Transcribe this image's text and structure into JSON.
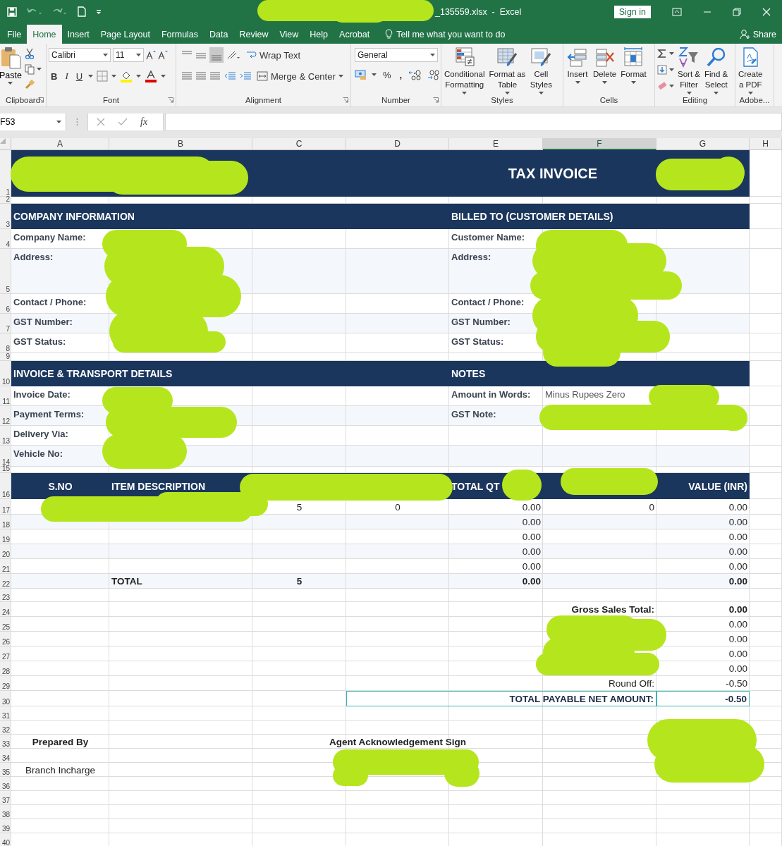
{
  "title_bar": {
    "title": "_135559.xlsx  -  Excel",
    "sign_in": "Sign in"
  },
  "menu_tabs": [
    {
      "label": "File",
      "selected": false
    },
    {
      "label": "Home",
      "selected": true
    },
    {
      "label": "Insert",
      "selected": false
    },
    {
      "label": "Page Layout",
      "selected": false
    },
    {
      "label": "Formulas",
      "selected": false
    },
    {
      "label": "Data",
      "selected": false
    },
    {
      "label": "Review",
      "selected": false
    },
    {
      "label": "View",
      "selected": false
    },
    {
      "label": "Help",
      "selected": false
    },
    {
      "label": "Acrobat",
      "selected": false
    }
  ],
  "tell_me": "Tell me what you want to do",
  "share": "Share",
  "ribbon": {
    "groups": [
      {
        "kind": "clipboard",
        "label": "Clipboard",
        "paste": "Paste"
      },
      {
        "kind": "font",
        "label": "Font",
        "font_name": "Calibri",
        "font_size": "11",
        "bold": "B",
        "italic": "I",
        "underline": "U"
      },
      {
        "kind": "alignment",
        "label": "Alignment",
        "wrap_text": "Wrap Text",
        "merge": "Merge & Center"
      },
      {
        "kind": "number",
        "label": "Number",
        "format": "General",
        "percent": "%",
        "comma": ","
      },
      {
        "kind": "large",
        "label": "Styles",
        "buttons": [
          {
            "kind": "conditional",
            "text": "Conditional\nFormatting"
          },
          {
            "kind": "table",
            "text": "Format as\nTable"
          },
          {
            "kind": "cell-styles",
            "text": "Cell\nStyles"
          }
        ]
      },
      {
        "kind": "large",
        "label": "Cells",
        "buttons": [
          {
            "kind": "insert",
            "text": "Insert"
          },
          {
            "kind": "delete",
            "text": "Delete"
          },
          {
            "kind": "format",
            "text": "Format"
          }
        ]
      },
      {
        "kind": "editing",
        "label": "Editing",
        "buttons": [
          {
            "kind": "sort",
            "text": "Sort &\nFilter"
          },
          {
            "kind": "find",
            "text": "Find &\nSelect"
          }
        ]
      },
      {
        "kind": "large",
        "label": "Adobe...",
        "buttons": [
          {
            "kind": "pdf",
            "text": "Create\na PDF"
          }
        ]
      }
    ]
  },
  "formula_bar": {
    "name_box": "F53",
    "function_button": "fx"
  },
  "sheet": {
    "columns": [
      {
        "label": "A",
        "selected": false
      },
      {
        "label": "B",
        "selected": false
      },
      {
        "label": "C",
        "selected": false
      },
      {
        "label": "D",
        "selected": false
      },
      {
        "label": "E",
        "selected": false
      },
      {
        "label": "F",
        "selected": true
      },
      {
        "label": "G",
        "selected": false
      },
      {
        "label": "H",
        "selected": false
      }
    ],
    "rows": [
      {
        "number": "1",
        "kind": "banner",
        "cells": {
          "E": {
            "kind": "title",
            "text": "TAX INVOICE"
          }
        }
      },
      {
        "number": "2",
        "kind": "plain"
      },
      {
        "number": "3",
        "kind": "banner",
        "cells": {
          "A": {
            "kind": "section",
            "text": "COMPANY INFORMATION"
          },
          "E": {
            "kind": "section",
            "text": "BILLED TO (CUSTOMER DETAILS)"
          }
        }
      },
      {
        "number": "4",
        "kind": "plain",
        "cells": {
          "A": {
            "kind": "label",
            "text": "Company Name:"
          },
          "E": {
            "kind": "label",
            "text": "Customer Name:"
          }
        }
      },
      {
        "number": "5",
        "kind": "shaded",
        "cells": {
          "A": {
            "kind": "label",
            "text": "Address:"
          },
          "E": {
            "kind": "label",
            "text": "Address:"
          }
        }
      },
      {
        "number": "6",
        "kind": "plain",
        "cells": {
          "A": {
            "kind": "label",
            "text": "Contact / Phone:"
          },
          "E": {
            "kind": "label",
            "text": "Contact / Phone:"
          }
        }
      },
      {
        "number": "7",
        "kind": "shaded",
        "cells": {
          "A": {
            "kind": "label",
            "text": "GST Number:"
          },
          "E": {
            "kind": "label",
            "text": "GST Number:"
          }
        }
      },
      {
        "number": "8",
        "kind": "plain",
        "cells": {
          "A": {
            "kind": "label",
            "text": "GST Status:"
          },
          "E": {
            "kind": "label",
            "text": "GST Status:"
          }
        }
      },
      {
        "number": "9",
        "kind": "plain"
      },
      {
        "number": "10",
        "kind": "banner",
        "cells": {
          "A": {
            "kind": "section",
            "text": "INVOICE & TRANSPORT DETAILS"
          },
          "E": {
            "kind": "section",
            "text": "NOTES"
          }
        }
      },
      {
        "number": "11",
        "kind": "plain",
        "cells": {
          "A": {
            "kind": "label",
            "text": "Invoice Date:"
          },
          "E": {
            "kind": "label",
            "text": "Amount in Words:"
          },
          "F": {
            "kind": "note",
            "text": "Minus Rupees Zero"
          }
        }
      },
      {
        "number": "12",
        "kind": "shaded",
        "cells": {
          "A": {
            "kind": "label",
            "text": "Payment Terms:"
          },
          "E": {
            "kind": "label",
            "text": "GST Note:"
          }
        }
      },
      {
        "number": "13",
        "kind": "plain",
        "cells": {
          "A": {
            "kind": "label",
            "text": "Delivery Via:"
          }
        }
      },
      {
        "number": "14",
        "kind": "shaded",
        "cells": {
          "A": {
            "kind": "label",
            "text": "Vehicle No:"
          }
        }
      },
      {
        "number": "15",
        "kind": "plain"
      },
      {
        "number": "16",
        "kind": "banner",
        "cells": {
          "A": {
            "kind": "head-center",
            "text": "S.NO"
          },
          "B": {
            "kind": "head",
            "text": "ITEM DESCRIPTION"
          },
          "E": {
            "kind": "head",
            "text": "TOTAL QT"
          },
          "G": {
            "kind": "head-right",
            "text": "VALUE (INR)"
          }
        }
      },
      {
        "number": "17",
        "kind": "plain",
        "cells": {
          "C": {
            "kind": "qty",
            "text": "5"
          },
          "D": {
            "kind": "qty",
            "text": "0"
          },
          "E": {
            "kind": "amount",
            "text": "0.00"
          },
          "F": {
            "kind": "amount",
            "text": "0"
          },
          "G": {
            "kind": "amount",
            "text": "0.00"
          }
        }
      },
      {
        "number": "18",
        "kind": "shaded",
        "cells": {
          "E": {
            "kind": "amount",
            "text": "0.00"
          },
          "G": {
            "kind": "amount",
            "text": "0.00"
          }
        }
      },
      {
        "number": "19",
        "kind": "plain",
        "cells": {
          "E": {
            "kind": "amount",
            "text": "0.00"
          },
          "G": {
            "kind": "amount",
            "text": "0.00"
          }
        }
      },
      {
        "number": "20",
        "kind": "shaded",
        "cells": {
          "E": {
            "kind": "amount",
            "text": "0.00"
          },
          "G": {
            "kind": "amount",
            "text": "0.00"
          }
        }
      },
      {
        "number": "21",
        "kind": "plain",
        "cells": {
          "E": {
            "kind": "amount",
            "text": "0.00"
          },
          "G": {
            "kind": "amount",
            "text": "0.00"
          }
        }
      },
      {
        "number": "22",
        "kind": "shaded",
        "cells": {
          "B": {
            "kind": "total-label",
            "text": "TOTAL"
          },
          "C": {
            "kind": "qty-bold",
            "text": "5"
          },
          "E": {
            "kind": "amount-bold",
            "text": "0.00"
          },
          "G": {
            "kind": "amount-bold",
            "text": "0.00"
          }
        }
      },
      {
        "number": "23",
        "kind": "plain"
      },
      {
        "number": "24",
        "kind": "plain",
        "cells": {
          "F": {
            "kind": "summary-label-bold",
            "text": "Gross Sales Total:"
          },
          "G": {
            "kind": "amount-bold",
            "text": "0.00"
          }
        }
      },
      {
        "number": "25",
        "kind": "plain",
        "cells": {
          "G": {
            "kind": "amount",
            "text": "0.00"
          }
        }
      },
      {
        "number": "26",
        "kind": "plain",
        "cells": {
          "G": {
            "kind": "amount",
            "text": "0.00"
          }
        }
      },
      {
        "number": "27",
        "kind": "plain",
        "cells": {
          "G": {
            "kind": "amount",
            "text": "0.00"
          }
        }
      },
      {
        "number": "28",
        "kind": "plain",
        "cells": {
          "G": {
            "kind": "amount",
            "text": "0.00"
          }
        }
      },
      {
        "number": "29",
        "kind": "plain",
        "cells": {
          "F": {
            "kind": "summary-label",
            "text": "Round Off:"
          },
          "G": {
            "kind": "amount",
            "text": "-0.50"
          }
        }
      },
      {
        "number": "30",
        "kind": "plain",
        "cells": {
          "D": {
            "kind": "net-label",
            "text": "TOTAL PAYABLE NET AMOUNT:",
            "outlined": true
          },
          "G": {
            "kind": "net-amount",
            "text": "-0.50",
            "outlined": true
          }
        }
      },
      {
        "number": "31",
        "kind": "plain"
      },
      {
        "number": "32",
        "kind": "plain"
      },
      {
        "number": "33",
        "kind": "plain",
        "cells": {
          "A": {
            "kind": "sign-heading",
            "text": "Prepared By"
          },
          "D": {
            "kind": "sign-heading",
            "text": "Agent Acknowledgement Sign"
          }
        }
      },
      {
        "number": "34",
        "kind": "plain"
      },
      {
        "number": "35",
        "kind": "plain",
        "cells": {
          "A": {
            "kind": "sign-text",
            "text": "Branch Incharge"
          }
        }
      },
      {
        "number": "36",
        "kind": "plain"
      },
      {
        "number": "37",
        "kind": "plain"
      },
      {
        "number": "38",
        "kind": "plain"
      },
      {
        "number": "39",
        "kind": "plain"
      },
      {
        "number": "40",
        "kind": "plain"
      }
    ]
  }
}
